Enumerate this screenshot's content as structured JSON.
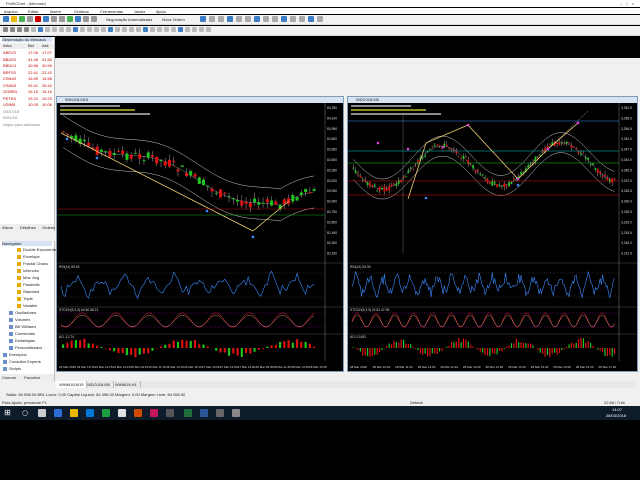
{
  "app": {
    "title": "ProfitChart - [Mercado]",
    "menu": [
      "Arquivo",
      "Editar",
      "Inserir",
      "Gráficos",
      "Ferramentas",
      "Janela",
      "Ajuda"
    ],
    "toolbar_buttons": [
      "Negociação Automatizada",
      "Nova Ordem"
    ]
  },
  "market_watch": {
    "title": "Observação do Mercado",
    "columns": [
      "Ativo",
      "Bid",
      "Ask"
    ],
    "rows": [
      {
        "symbol": "ABEV3",
        "bid": "17.06",
        "ask": "17.07",
        "color": "#c00000"
      },
      {
        "symbol": "BBAS3",
        "bid": "41.48",
        "ask": "41.50",
        "color": "#c00000"
      },
      {
        "symbol": "BBDC4",
        "bid": "40.98",
        "ask": "40.99",
        "color": "#c00000"
      },
      {
        "symbol": "BRFS3",
        "bid": "22.41",
        "ask": "22.42",
        "color": "#c00000"
      },
      {
        "symbol": "CSNA3",
        "bid": "15.55",
        "ask": "15.56",
        "color": "#c00000"
      },
      {
        "symbol": "CSAN3",
        "bid": "25.41",
        "ask": "25.42",
        "color": "#c00000"
      },
      {
        "symbol": "GGBR4",
        "bid": "15.15",
        "ask": "15.16",
        "color": "#c00000"
      },
      {
        "symbol": "PETR4",
        "bid": "19.22",
        "ask": "19.23",
        "color": "#c00000"
      },
      {
        "symbol": "USIM5",
        "bid": "10.05",
        "ask": "10.06",
        "color": "#c00000"
      },
      {
        "symbol": "WDOJ18",
        "bid": "",
        "ask": "",
        "color": "#888888"
      },
      {
        "symbol": "WINJ18",
        "bid": "",
        "ask": "",
        "color": "#888888"
      },
      {
        "symbol": "clique para adicionar",
        "bid": "",
        "ask": "",
        "color": "#888888"
      }
    ],
    "tabs": [
      "Ativos",
      "Detalhes",
      "Ordens"
    ]
  },
  "navigator": {
    "title": "Navegador",
    "items": [
      "Double Exponential",
      "Envelope",
      "Fractal Chaos",
      "Ichimoku",
      "Mov. Avg",
      "Parabolic",
      "Standard",
      "Triple",
      "Variable",
      "Osciladores",
      "Volumes",
      "Bill Williams",
      "Comerciais",
      "Estratégias",
      "Personalizados",
      "Exemplos",
      "Consultor Experts",
      "Scripts"
    ],
    "tabs": [
      "Comum",
      "Favoritos"
    ]
  },
  "charts": [
    {
      "title": "WINJ18,M15",
      "price_labels": [
        "84,250",
        "84,100",
        "83,950",
        "83,800",
        "83,650",
        "83,500",
        "83,350",
        "83,200",
        "83,050",
        "82,900",
        "82,750",
        "82,600",
        "82,450",
        "82,300",
        "82,150"
      ],
      "osc1_label": "RSI(14) 59.82",
      "osc2_label": "STOCH(5,3,3) 64.50 58.21",
      "osc3_label": "AO -12.74",
      "time_labels": [
        "22 Mar 2018",
        "23 Mar 10:15",
        "23 Mar 12:15",
        "23 Mar 14:15",
        "26 Mar 09:15",
        "26 Mar 11:15",
        "26 Mar 13:15",
        "26 Mar 15:15",
        "27 Mar 10:00",
        "27 Mar 12:00",
        "27 Mar 14:00",
        "28 Mar 09:45",
        "28 Mar 11:45",
        "28 Mar 13:45",
        "28 Mar 15:45"
      ]
    },
    {
      "title": "WDOJ18,M5",
      "price_labels": [
        "3,361.5",
        "3,358.0",
        "3,354.5",
        "3,351.0",
        "3,347.5",
        "3,344.0",
        "3,340.5",
        "3,337.0",
        "3,333.5",
        "3,330.0",
        "3,326.5",
        "3,323.0",
        "3,319.5",
        "3,316.0",
        "3,312.5"
      ],
      "osc1_label": "RSI(14) 53.30",
      "osc2_label": "STOCH(5,3,3) 42.81 47.95",
      "osc3_label": "AO 0.2453",
      "time_labels": [
        "28 Mar 2018",
        "28 Mar 10:40",
        "28 Mar 11:20",
        "28 Mar 12:00",
        "28 Mar 12:40",
        "28 Mar 13:20",
        "28 Mar 14:00",
        "28 Mar 14:40",
        "28 Mar 15:20",
        "28 Mar 16:00",
        "28 Mar 16:40",
        "28 Mar 17:20"
      ]
    }
  ],
  "chart_tabs": [
    "WINM18,M15",
    "WDOJ18,M5",
    "WINM18,H1"
  ],
  "status": {
    "balance": "Saldo: 84 096.00 BRL  Lucro: 0.00  Capital Líquido: 84 096.00  Margem: 0.00  Margem Livre: 84 096.00",
    "help": "Para Ajuda, pressione F1",
    "profile": "Default",
    "speed": "22.66 / 0 kb"
  },
  "taskbar": {
    "time": "14:07",
    "date": "28/03/2018"
  }
}
